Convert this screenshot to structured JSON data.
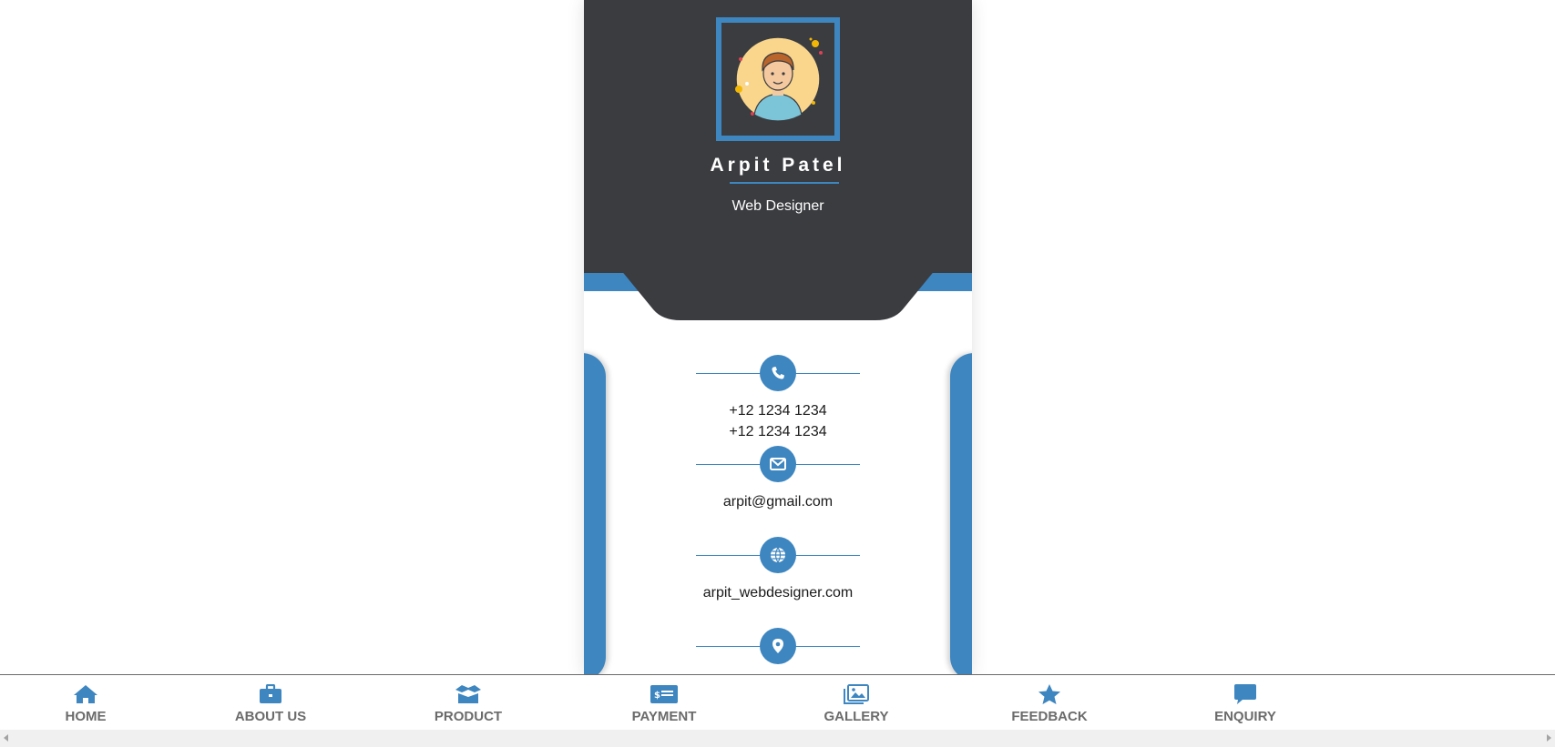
{
  "profile": {
    "name": "Arpit Patel",
    "role": "Web Designer"
  },
  "contacts": {
    "phone_1": "+12 1234 1234",
    "phone_2": "+12 1234 1234",
    "email": "arpit@gmail.com",
    "website": "arpit_webdesigner.com"
  },
  "nav": {
    "home": "HOME",
    "about": "ABOUT US",
    "product": "PRODUCT",
    "payment": "PAYMENT",
    "gallery": "GALLERY",
    "feedback": "FEEDBACK",
    "enquiry": "ENQUIRY"
  },
  "icons": [
    "phone-icon",
    "envelope-icon",
    "globe-icon",
    "location-pin-icon",
    "home-icon",
    "briefcase-icon",
    "box-icon",
    "money-bill-icon",
    "image-icon",
    "star-icon",
    "chat-icon"
  ],
  "colors": {
    "accent": "#3e86c0",
    "header_bg": "#3b3c40",
    "nav_label": "#6b6b6b"
  }
}
